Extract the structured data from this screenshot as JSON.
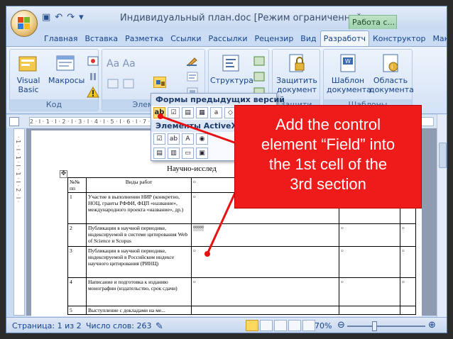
{
  "window": {
    "title": "Индивидуальный план.doc [Режим ограниченной ...",
    "context_tab": "Работа с..."
  },
  "tabs": [
    "Главная",
    "Вставка",
    "Разметка",
    "Ссылки",
    "Рассылки",
    "Рецензир",
    "Вид",
    "Разработч",
    "Конструктор",
    "Макет"
  ],
  "active_tab_index": 7,
  "ribbon": {
    "code": {
      "title": "Код",
      "visual_basic": "Visual Basic",
      "macros": "Макросы"
    },
    "controls": {
      "title": "Элементы"
    },
    "xml": {
      "structure": "Структура"
    },
    "protect": {
      "title": "Защити",
      "label": "Защитить документ"
    },
    "templates": {
      "title": "Шаблоны",
      "template": "Шаблон документа",
      "region": "Область документа"
    },
    "text_btn": "Аа Аа"
  },
  "gallery": {
    "heading1": "Формы предыдущих версий",
    "heading2": "Элементы ActiveX",
    "first_label": "ab"
  },
  "ruler": {
    "h": "2 · I · 1 · I · 2 · I · 3 · I · 4 · I · 5 · I · 6 · I · 7 · I · 8 · I · 9 · I · 10",
    "v": "· 1 · I · 1 · I · 1 · I · 2 · I ·"
  },
  "document": {
    "heading": "Научно-исслед",
    "header_num": "№№ пп",
    "header_type": "Виды работ",
    "rows": [
      {
        "num": "1",
        "text": "Участие в выполнении НИР (конкретно, НОЦ, гранты РФФИ, ФЦП «название», международного проекта «название», др.)"
      },
      {
        "num": "2",
        "text": "Публикации в научной периодике, индексируемой в системе цитирования Web of Science и Scopus"
      },
      {
        "num": "3",
        "text": "Публикации в научной периодике, индексируемой в Российском индексе научного цитирования (РИНЦ)"
      },
      {
        "num": "4",
        "text": "Написание и подготовка к изданию монографии (издательство, срок сдачи)"
      },
      {
        "num": "5",
        "text": "Выступление с докладами на ме..."
      }
    ],
    "cell_mark": "¤",
    "dots_mark": "°°°°°"
  },
  "status": {
    "page": "Страница: 1 из 2",
    "words": "Число слов: 263",
    "zoom": "70%",
    "zoom_fraction": 0.7
  },
  "callout": {
    "lines": [
      "Add the control",
      "element “Field” into",
      "the 1st cell of the",
      "3rd section"
    ],
    "bg_color": "#ef1a1a",
    "arrow_color": "#e81010"
  }
}
